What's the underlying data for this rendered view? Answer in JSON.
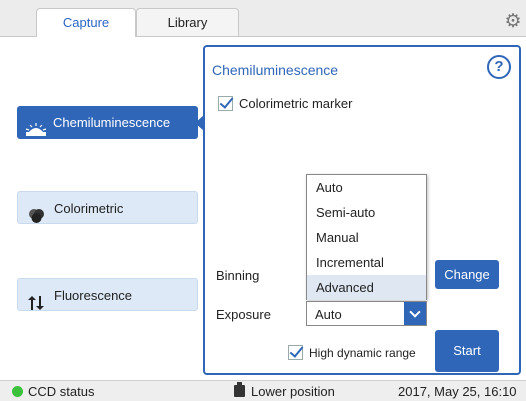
{
  "tabs": [
    {
      "label": "Capture",
      "active": true
    },
    {
      "label": "Library",
      "active": false
    }
  ],
  "settings_icon": "gear-icon",
  "modes": {
    "chemiluminescence": {
      "label": "Chemiluminescence",
      "icon": "chemiluminescence-icon",
      "active": true
    },
    "colorimetric": {
      "label": "Colorimetric",
      "icon": "colorimetric-icon",
      "active": false
    },
    "fluorescence": {
      "label": "Fluorescence",
      "icon": "fluorescence-icon",
      "active": false
    }
  },
  "panel": {
    "title": "Chemiluminescence",
    "help": "?",
    "colorimetric_marker": {
      "label": "Colorimetric marker",
      "checked": true
    },
    "binning_label": "Binning",
    "exposure_label": "Exposure",
    "exposure_options": [
      "Auto",
      "Semi-auto",
      "Manual",
      "Incremental",
      "Advanced"
    ],
    "exposure_highlighted": "Advanced",
    "exposure_value": "Auto",
    "change_button": "Change",
    "start_button": "Start",
    "high_dynamic_range": {
      "label": "High dynamic range",
      "checked": true
    }
  },
  "status_bar": {
    "ccd_status": "CCD status",
    "ccd_color": "#3cc13c",
    "position": "Lower position",
    "datetime": "2017, May 25, 16:10"
  },
  "colors": {
    "accent": "#2f66b8",
    "inactive_button": "#dde9f6"
  }
}
